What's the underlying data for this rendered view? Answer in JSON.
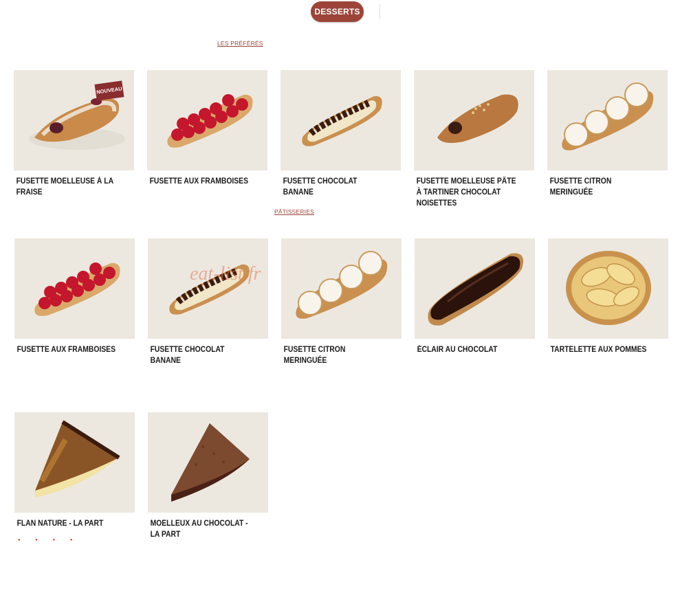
{
  "header": {
    "category_button": "DESSERTS"
  },
  "sections": {
    "favorites": "LES PRÉFÉRÉS",
    "pastries": "PÂTISSERIES"
  },
  "products": {
    "row1": [
      {
        "name": "FUSETTE MOELLEUSE À LA FRAISE",
        "badge": "NOUVEAU"
      },
      {
        "name": "FUSETTE AUX FRAMBOISES"
      },
      {
        "name": "FUSETTE CHOCOLAT BANANE"
      },
      {
        "name": "FUSETTE MOELLEUSE PÂTE À TARTINER CHOCOLAT NOISETTES"
      },
      {
        "name": "FUSETTE CITRON MERINGUÉE"
      }
    ],
    "row2": [
      {
        "name": "FUSETTE AUX FRAMBOISES"
      },
      {
        "name": "FUSETTE CHOCOLAT BANANE"
      },
      {
        "name": "FUSETTE CITRON MERINGUÉE"
      },
      {
        "name": "ÉCLAIR AU CHOCOLAT"
      },
      {
        "name": "TARTELETTE AUX POMMES"
      }
    ],
    "row3": [
      {
        "name": "FLAN NATURE - LA PART"
      },
      {
        "name": "MOELLEUX AU CHOCOLAT - LA PART"
      }
    ]
  },
  "watermark": "eat-list.fr",
  "colors": {
    "accent": "#9c4438",
    "image_bg": "#ece8e0"
  }
}
